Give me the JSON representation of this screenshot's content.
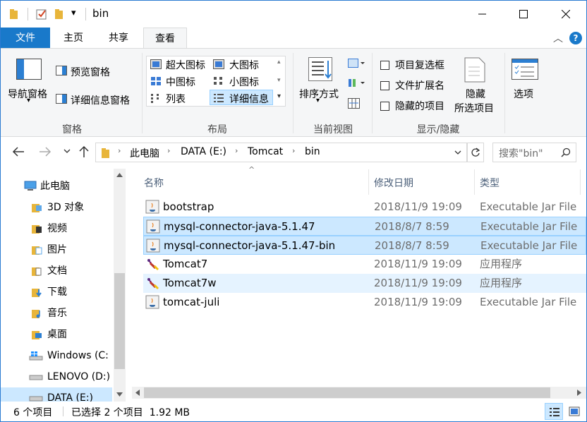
{
  "window": {
    "title": "bin",
    "quick_access_glyph": "▾",
    "minimize": "—",
    "maximize": "☐",
    "close": "✕"
  },
  "ribbon_tabs": [
    "文件",
    "主页",
    "共享",
    "查看"
  ],
  "ribbon": {
    "pane_group": {
      "nav_pane": "导航窗格",
      "preview_pane": "预览窗格",
      "details_pane": "详细信息窗格",
      "label": "窗格"
    },
    "layout_group": {
      "items": [
        "超大图标",
        "大图标",
        "中图标",
        "小图标",
        "列表",
        "详细信息"
      ],
      "selected": "详细信息",
      "label": "布局"
    },
    "current_view_group": {
      "sort_by": "排序方式",
      "label": "当前视图"
    },
    "show_hide_group": {
      "item_checkboxes": "项目复选框",
      "file_extensions": "文件扩展名",
      "hidden_items": "隐藏的项目",
      "hide_selected_line1": "隐藏",
      "hide_selected_line2": "所选项目",
      "options": "选项",
      "label": "显示/隐藏"
    },
    "help_glyph": "?",
    "collapse_glyph": "︿"
  },
  "address": {
    "crumbs": [
      "此电脑",
      "DATA (E:)",
      "Tomcat",
      "bin"
    ],
    "search_placeholder": "搜索\"bin\""
  },
  "nav_pane": {
    "items": [
      {
        "label": "此电脑",
        "icon": "computer-icon"
      },
      {
        "label": "3D 对象",
        "icon": "3d-objects-icon"
      },
      {
        "label": "视频",
        "icon": "videos-icon"
      },
      {
        "label": "图片",
        "icon": "pictures-icon"
      },
      {
        "label": "文档",
        "icon": "documents-icon"
      },
      {
        "label": "下载",
        "icon": "downloads-icon"
      },
      {
        "label": "音乐",
        "icon": "music-icon"
      },
      {
        "label": "桌面",
        "icon": "desktop-icon"
      },
      {
        "label": "Windows (C:",
        "icon": "windows-drive-icon"
      },
      {
        "label": "LENOVO (D:)",
        "icon": "drive-icon"
      },
      {
        "label": "DATA (E:)",
        "icon": "drive-icon"
      }
    ]
  },
  "file_list": {
    "columns": [
      "名称",
      "修改日期",
      "类型"
    ],
    "sort_glyph": "^",
    "rows": [
      {
        "name": "bootstrap",
        "date": "2018/11/9 19:09",
        "type": "Executable Jar File",
        "icon": "jar-file-icon",
        "state": "normal"
      },
      {
        "name": "mysql-connector-java-5.1.47",
        "date": "2018/8/7 8:59",
        "type": "Executable Jar File",
        "icon": "jar-file-icon",
        "state": "selected"
      },
      {
        "name": "mysql-connector-java-5.1.47-bin",
        "date": "2018/8/7 8:59",
        "type": "Executable Jar File",
        "icon": "jar-file-icon",
        "state": "selected"
      },
      {
        "name": "Tomcat7",
        "date": "2018/11/9 19:09",
        "type": "应用程序",
        "icon": "tomcat-exe-icon",
        "state": "normal"
      },
      {
        "name": "Tomcat7w",
        "date": "2018/11/9 19:09",
        "type": "应用程序",
        "icon": "tomcat-exe-icon",
        "state": "hover"
      },
      {
        "name": "tomcat-juli",
        "date": "2018/11/9 19:09",
        "type": "Executable Jar File",
        "icon": "jar-file-icon",
        "state": "normal"
      }
    ]
  },
  "status_bar": {
    "item_count": "6 个项目",
    "selection": "已选择 2 个项目  1.92 MB"
  },
  "colors": {
    "file_tab": "#1979ca",
    "selection": "#cce8ff",
    "hover": "#e5f3ff"
  }
}
